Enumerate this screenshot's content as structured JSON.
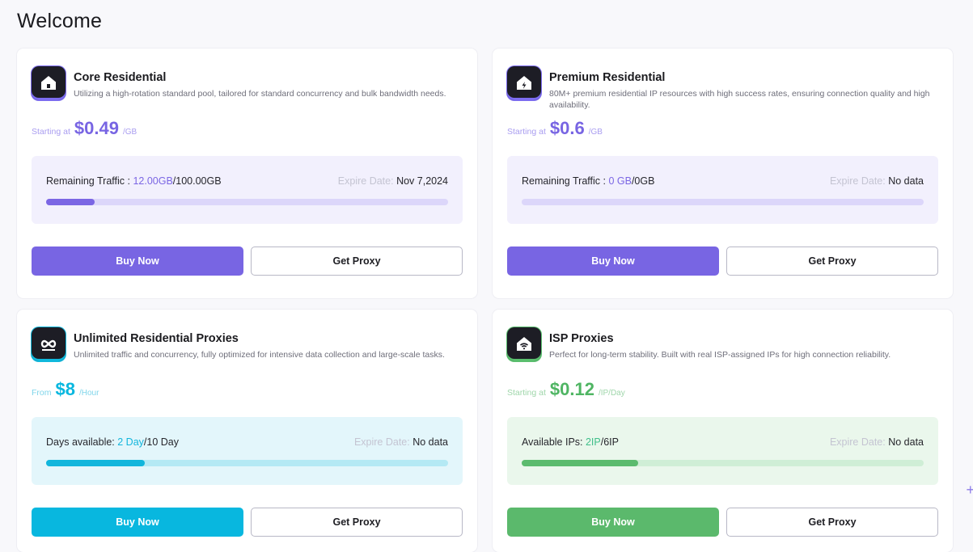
{
  "page": {
    "title": "Welcome"
  },
  "cards": [
    {
      "title": "Core Residential",
      "description": "Utilizing a high-rotation standard pool, tailored for standard concurrency and bulk bandwidth needs.",
      "price_prefix": "Starting at",
      "price": "$0.49",
      "price_unit": "/GB",
      "usage_label": "Remaining Traffic : ",
      "usage_used": "12.00GB",
      "usage_total": "/100.00GB",
      "usage_fraction": 0.12,
      "expire_label": "Expire Date: ",
      "expire_value": "Nov 7,2024",
      "buy_label": "Buy Now",
      "proxy_label": "Get Proxy",
      "accent": "#7865e3",
      "icon": "house-icon"
    },
    {
      "title": "Premium Residential",
      "description": "80M+ premium residential IP resources with high success rates, ensuring connection quality and high availability.",
      "price_prefix": "Starting at",
      "price": "$0.6",
      "price_unit": "/GB",
      "usage_label": "Remaining Traffic : ",
      "usage_used": "0 GB",
      "usage_total": "/0GB",
      "usage_fraction": 0,
      "expire_label": "Expire Date: ",
      "expire_value": "No data",
      "buy_label": "Buy Now",
      "proxy_label": "Get Proxy",
      "accent": "#7865e3",
      "icon": "house-lightning-icon"
    },
    {
      "title": "Unlimited Residential Proxies",
      "description": "Unlimited traffic and concurrency, fully optimized for intensive data collection and large-scale tasks.",
      "price_prefix": "From",
      "price": "$8",
      "price_unit": "/Hour",
      "usage_label": "Days available: ",
      "usage_used": "2 Day",
      "usage_total": "/10 Day",
      "usage_fraction": 0.245,
      "expire_label": "Expire Date: ",
      "expire_value": "No data",
      "buy_label": "Buy Now",
      "proxy_label": "Get Proxy",
      "accent": "#08b7df",
      "icon": "infinity-icon"
    },
    {
      "title": "ISP Proxies",
      "description": "Perfect for long-term stability. Built with real ISP-assigned IPs for high connection reliability.",
      "price_prefix": "Starting at",
      "price": "$0.12",
      "price_unit": "/IP/Day",
      "usage_label": "Available IPs: ",
      "usage_used": "2IP",
      "usage_total": "/6IP",
      "usage_fraction": 0.29,
      "expire_label": "Expire Date: ",
      "expire_value": "No data",
      "buy_label": "Buy Now",
      "proxy_label": "Get Proxy",
      "accent": "#5bb96c",
      "icon": "wifi-house-icon"
    }
  ]
}
